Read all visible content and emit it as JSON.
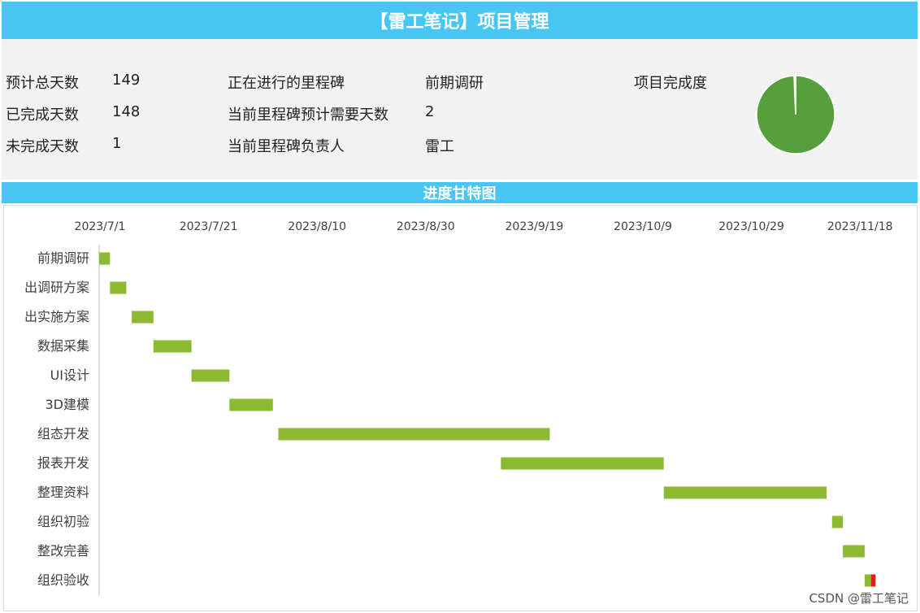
{
  "header": {
    "title": "【雷工笔记】项目管理"
  },
  "section_title": "进度甘特图",
  "summary": {
    "planned_days_label": "预计总天数",
    "planned_days_value": "149",
    "done_days_label": "已完成天数",
    "done_days_value": "148",
    "remaining_days_label": "未完成天数",
    "remaining_days_value": "1",
    "current_milestone_label": "正在进行的里程碑",
    "current_milestone_value": "前期调研",
    "milestone_days_label": "当前里程碑预计需要天数",
    "milestone_days_value": "2",
    "milestone_owner_label": "当前里程碑负责人",
    "milestone_owner_value": "雷工",
    "completion_label": "项目完成度"
  },
  "colors": {
    "accent": "#47c6f4",
    "bar": "#8bba32",
    "pie_done": "#55a03a",
    "pie_rest": "#ffffff",
    "remaining": "#e01b24"
  },
  "completion_pie": {
    "type": "pie",
    "slices": [
      {
        "label": "已完成",
        "value": 148
      },
      {
        "label": "未完成",
        "value": 1
      }
    ]
  },
  "chart_data": {
    "type": "bar",
    "orientation": "horizontal-gantt",
    "x_ticks": [
      "2023/7/1",
      "2023/7/21",
      "2023/8/10",
      "2023/8/30",
      "2023/9/19",
      "2023/10/9",
      "2023/10/29",
      "2023/11/18"
    ],
    "xlim": [
      "2023/7/1",
      "2023/11/30"
    ],
    "tasks": [
      {
        "name": "前期调研",
        "start": "2023/7/1",
        "end": "2023/7/3"
      },
      {
        "name": "出调研方案",
        "start": "2023/7/3",
        "end": "2023/7/6"
      },
      {
        "name": "出实施方案",
        "start": "2023/7/7",
        "end": "2023/7/11"
      },
      {
        "name": "数据采集",
        "start": "2023/7/11",
        "end": "2023/7/18"
      },
      {
        "name": "UI设计",
        "start": "2023/7/18",
        "end": "2023/7/25"
      },
      {
        "name": "3D建模",
        "start": "2023/7/25",
        "end": "2023/8/2"
      },
      {
        "name": "组态开发",
        "start": "2023/8/3",
        "end": "2023/9/22"
      },
      {
        "name": "报表开发",
        "start": "2023/9/13",
        "end": "2023/10/13"
      },
      {
        "name": "整理资料",
        "start": "2023/10/13",
        "end": "2023/11/12"
      },
      {
        "name": "组织初验",
        "start": "2023/11/13",
        "end": "2023/11/15"
      },
      {
        "name": "整改完善",
        "start": "2023/11/15",
        "end": "2023/11/19"
      },
      {
        "name": "组织验收",
        "start": "2023/11/19",
        "end": "2023/11/21",
        "remaining_days": 1
      }
    ]
  },
  "watermark": "CSDN @雷工笔记"
}
